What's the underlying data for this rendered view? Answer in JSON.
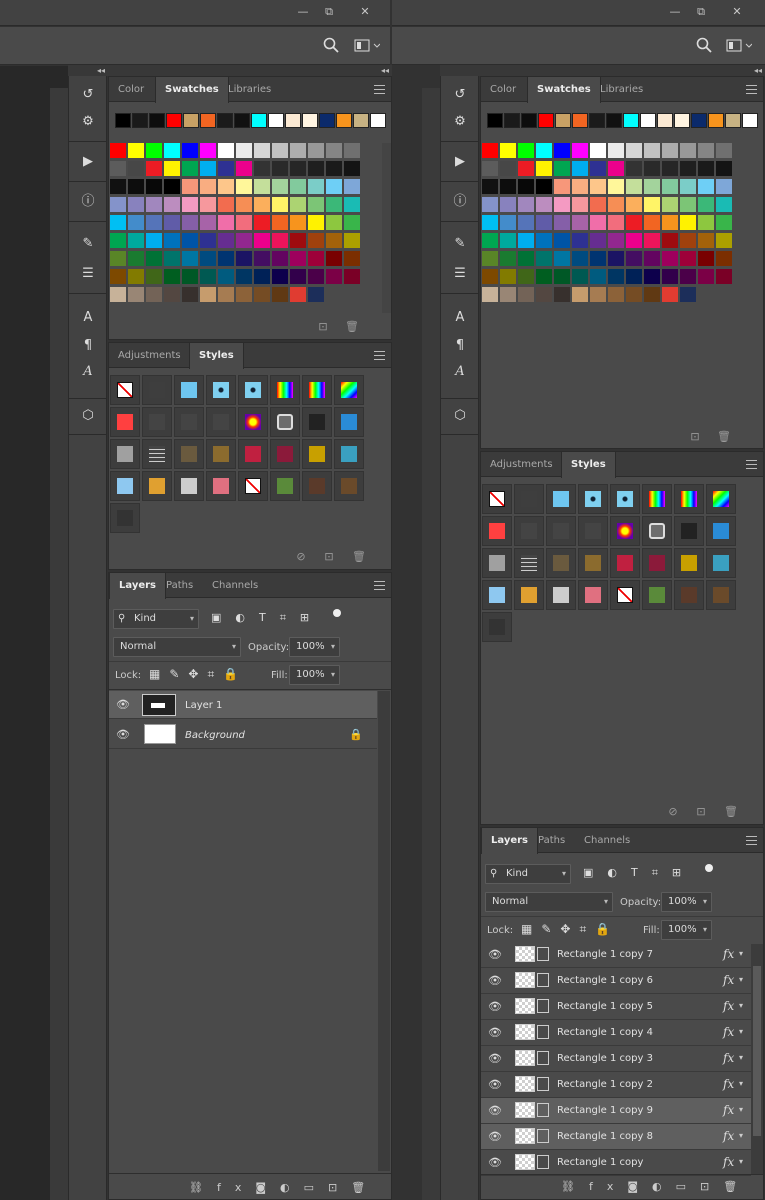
{
  "window_controls": {
    "minimize": "—",
    "restore": "⧉",
    "close": "✕"
  },
  "left": {
    "tabs_color": [
      "Color",
      "Swatches",
      "Libraries"
    ],
    "tabs_styles": [
      "Adjustments",
      "Styles"
    ],
    "tabs_layers": [
      "Layers",
      "Paths",
      "Channels"
    ],
    "kind_label": "Kind",
    "blend_mode": "Normal",
    "opacity_label": "Opacity:",
    "opacity_value": "100%",
    "lock_label": "Lock:",
    "fill_label": "Fill:",
    "fill_value": "100%",
    "layers": [
      {
        "name": "Layer 1",
        "selected": true,
        "italic": false
      },
      {
        "name": "Background",
        "selected": false,
        "italic": true
      }
    ]
  },
  "right": {
    "tabs_color": [
      "Color",
      "Swatches",
      "Libraries"
    ],
    "tabs_styles": [
      "Adjustments",
      "Styles"
    ],
    "tabs_layers": [
      "Layers",
      "Paths",
      "Channels"
    ],
    "kind_label": "Kind",
    "blend_mode": "Normal",
    "opacity_label": "Opacity:",
    "opacity_value": "100%",
    "lock_label": "Lock:",
    "fill_label": "Fill:",
    "fill_value": "100%",
    "layers": [
      {
        "name": "Rectangle 1 copy 7",
        "selected": false
      },
      {
        "name": "Rectangle 1 copy 6",
        "selected": false
      },
      {
        "name": "Rectangle 1 copy 5",
        "selected": false
      },
      {
        "name": "Rectangle 1 copy 4",
        "selected": false
      },
      {
        "name": "Rectangle 1 copy 3",
        "selected": false
      },
      {
        "name": "Rectangle 1 copy 2",
        "selected": false
      },
      {
        "name": "Rectangle 1 copy 9",
        "selected": true
      },
      {
        "name": "Rectangle 1 copy 8",
        "selected": true
      },
      {
        "name": "Rectangle 1 copy",
        "selected": false
      }
    ],
    "fx_label": "fx"
  },
  "colors": {
    "recent": [
      "#000000",
      "#1a1a1a",
      "#0d0d0d",
      "#ff0000",
      "#c8a165",
      "#f26522",
      "#1b1b1b",
      "#111111",
      "#00ffff",
      "#ffffff",
      "#fbe9d3",
      "#fff4e1",
      "#0b2a6b",
      "#f7941d",
      "#c7b283",
      "#ffffff"
    ],
    "grid": [
      [
        "#ff0000",
        "#ffff00",
        "#00ff00",
        "#00ffff",
        "#0000ff",
        "#ff00ff",
        "#ffffff",
        "#ebebeb",
        "#d6d6d6",
        "#c2c2c2",
        "#adadad",
        "#999999",
        "#858585",
        "#707070"
      ],
      [
        "#5c5c5c",
        "#474747",
        "#ed1c24",
        "#fff200",
        "#00a651",
        "#00aeef",
        "#2e3192",
        "#ec008c",
        "#333333",
        "#2a2a2a",
        "#262626",
        "#1f1f1f",
        "#1a1a1a",
        "#141414"
      ],
      [
        "#111111",
        "#0d0d0d",
        "#080808",
        "#000000",
        "#f7977a",
        "#f9ad81",
        "#fdc68a",
        "#fff79a",
        "#c4df9b",
        "#a3d39c",
        "#82ca9d",
        "#7bcdc8",
        "#6ecff6",
        "#7ea7d8"
      ],
      [
        "#8493ca",
        "#8882be",
        "#a187be",
        "#bc8dbf",
        "#f49ac2",
        "#f6989d",
        "#f26c4f",
        "#f68e55",
        "#fbaf5c",
        "#fff467",
        "#acd372",
        "#7cc576",
        "#3bb878",
        "#1abbb4"
      ],
      [
        "#00bff3",
        "#438ccb",
        "#5574b9",
        "#605ca8",
        "#855fa8",
        "#a763a8",
        "#f06ea9",
        "#f26d7d",
        "#ed1c24",
        "#f26522",
        "#f7941d",
        "#fff200",
        "#8dc73f",
        "#39b54a"
      ],
      [
        "#00a651",
        "#00a99d",
        "#00aeef",
        "#0072bc",
        "#0054a6",
        "#2e3192",
        "#662d91",
        "#92278f",
        "#ec008c",
        "#ed145b",
        "#9e0b0f",
        "#a0410d",
        "#a3620a",
        "#aba000"
      ],
      [
        "#598527",
        "#1a7b30",
        "#007236",
        "#00746b",
        "#0076a3",
        "#004b80",
        "#003471",
        "#1b1464",
        "#440e62",
        "#630460",
        "#9e005d",
        "#9e0039",
        "#790000",
        "#7b2e00"
      ],
      [
        "#7d4900",
        "#827b00",
        "#406618",
        "#005e20",
        "#005826",
        "#005952",
        "#005b7f",
        "#003663",
        "#002157",
        "#0d004c",
        "#32004b",
        "#4b0049",
        "#7b0046",
        "#7a0026"
      ],
      [
        "#c7b299",
        "#998675",
        "#736357",
        "#534741",
        "#37302d",
        "#c69c6d",
        "#a67c52",
        "#8c6239",
        "#754c24",
        "#603913",
        "#e03c31",
        "#1c2e5a",
        "#4a4a4a",
        "#4a4a4a"
      ]
    ],
    "styles": [
      [
        "none",
        "#3e3e3e",
        "#6ec6f0",
        "dot",
        "dot",
        "rainbowv",
        "rainbowv",
        "rainbowh"
      ],
      [
        "#ff4040",
        "#444",
        "#444",
        "#444",
        "sun",
        "ring",
        "#222",
        "#2a8bd6"
      ],
      [
        "#a0a0a0",
        "text",
        "#6a5a3e",
        "#8b6b2e",
        "#c02040",
        "#8b1a3a",
        "#c8a000",
        "#3aa0c0"
      ],
      [
        "#8ec8f0",
        "#e0a030",
        "#cccccc",
        "#e07080",
        "none",
        "#5a8a3a",
        "#5a3a2a",
        "#6a4a2a"
      ],
      [
        "#333333"
      ]
    ]
  }
}
